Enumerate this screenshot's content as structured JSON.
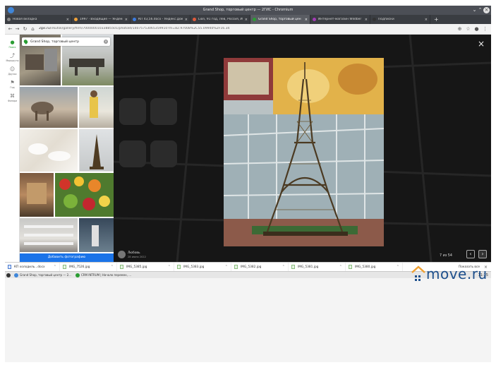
{
  "window": {
    "title": "Grand Shop, торговый центр — 2ГИС - Chromium"
  },
  "tabs": [
    {
      "label": "Новая вкладка",
      "color": "#888888"
    },
    {
      "label": "1997 · Входящие — Яндекс",
      "color": "#f2a33a"
    },
    {
      "label": "КП 43,56.docx - Яндекс.Док",
      "color": "#3b7be0"
    },
    {
      "label": "Lion, 91 год, Лев, Россия, Ирк",
      "color": "#e05a3b"
    },
    {
      "label": "Grand Shop, торговый цен",
      "color": "#2a9d33",
      "active": true
    },
    {
      "label": "Интернет-магазин Wildber",
      "color": "#a23bb5"
    },
    {
      "label": "Подписки",
      "color": "#333333"
    }
  ],
  "address": {
    "host": "2gis.ru",
    "path": "/irkutsk/gallery/firm/70000001033885501/photoId/14075753065359910?m=82.97008%2C55.09940%2F16.34"
  },
  "rail": [
    {
      "label": "Поиск",
      "icon": "search-pin-icon",
      "active": true
    },
    {
      "label": "Маршруты",
      "icon": "route-icon"
    },
    {
      "label": "Друзья",
      "icon": "friends-icon"
    },
    {
      "label": "Гид",
      "icon": "flag-icon"
    },
    {
      "label": "Фонари",
      "icon": "bookmark-icon"
    }
  ],
  "gallery": {
    "title": "Grand Shop, торговый центр",
    "add_photo": "Добавить фотографию"
  },
  "viewer": {
    "counter": "7 из 54",
    "author": "Любовь",
    "date": "28 июня 2022"
  },
  "downloads": {
    "items": [
      "КП холодиль...docx",
      "IMG_7526.jpg",
      "IMG_5385.jpg",
      "IMG_5383.jpg",
      "IMG_5382.jpg",
      "IMG_5381.jpg",
      "IMG_5380.jpg"
    ],
    "show_all": "Показать все"
  },
  "taskbar": {
    "items": [
      "Grand Shop, торговый центр — 2...",
      "CRM INTRUM | Начало перемен, ..."
    ],
    "clock": "11:25"
  },
  "watermark": {
    "text": "move.ru"
  }
}
